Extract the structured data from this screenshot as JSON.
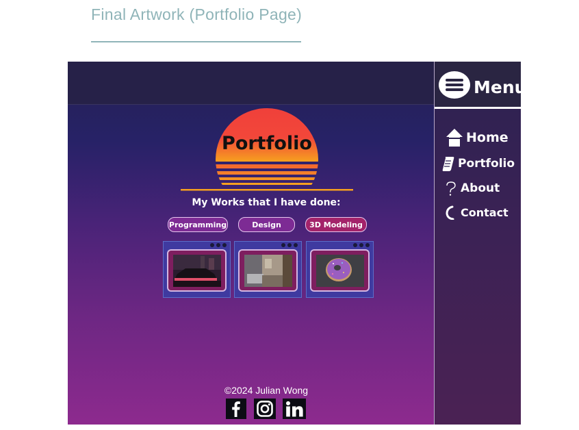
{
  "document": {
    "title": "Final Artwork (Portfolio Page)"
  },
  "side_menu": {
    "label": "Menu",
    "items": [
      {
        "label": "Home",
        "icon": "house-icon"
      },
      {
        "label": "Portfolio",
        "icon": "scroll-icon"
      },
      {
        "label": "About",
        "icon": "question-icon"
      },
      {
        "label": "Contact",
        "icon": "phone-icon"
      }
    ]
  },
  "hero": {
    "title": "Portfolio",
    "sun_colors": [
      "#f0453a",
      "#f6a21f"
    ]
  },
  "works": {
    "heading": "My Works that I have done:",
    "categories": [
      "Programming",
      "Design",
      "3D Modeling"
    ],
    "thumbnails": [
      "retro-car-image",
      "room-render-image",
      "donut-render-image"
    ]
  },
  "footer": {
    "copyright": "©2024 Julian Wong",
    "social": [
      "facebook-icon",
      "instagram-icon",
      "linkedin-icon"
    ]
  },
  "colors": {
    "accent_teal": "#8fb4b8",
    "button_purple": "#7d2b94",
    "button_magenta": "#a3236a"
  }
}
